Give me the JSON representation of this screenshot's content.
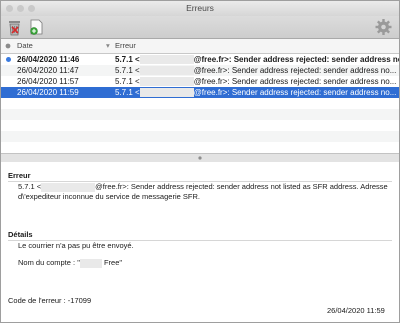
{
  "window": {
    "title": "Erreurs"
  },
  "toolbar": {
    "delete_icon": "trash-icon",
    "new_message_icon": "document-add-icon",
    "settings_icon": "gear-icon"
  },
  "table": {
    "columns": [
      "Date",
      "Erreur"
    ],
    "rows": [
      {
        "date": "26/04/2020 11:46",
        "prefix": "5.7.1 <",
        "suffix": "@free.fr>: Sender address rejected: sender address not",
        "bold": true,
        "unread": true,
        "selected": false
      },
      {
        "date": "26/04/2020 11:47",
        "prefix": "5.7.1 <",
        "suffix": "@free.fr>: Sender address rejected: sender address no...",
        "bold": false,
        "unread": false,
        "selected": false
      },
      {
        "date": "26/04/2020 11:57",
        "prefix": "5.7.1 <",
        "suffix": "@free.fr>: Sender address rejected: sender address no...",
        "bold": false,
        "unread": false,
        "selected": false
      },
      {
        "date": "26/04/2020 11:59",
        "prefix": "5.7.1 <",
        "suffix": "@free.fr>: Sender address rejected: sender address no...",
        "bold": false,
        "unread": false,
        "selected": true
      }
    ]
  },
  "detail": {
    "error_title": "Erreur",
    "error_prefix": "5.7.1 <",
    "error_line1_suffix": "@free.fr>: Sender address rejected: sender address not listed as SFR address. Adresse",
    "error_line2": "d\\'expediteur inconnue du service de messagerie SFR.",
    "details_title": "Détails",
    "message": "Le courrier n'a pas pu être envoyé.",
    "account_prefix": "Nom du compte : \"",
    "account_suffix": " Free\"",
    "code_label": "Code de l'erreur : -17099",
    "timestamp": "26/04/2020 11:59"
  },
  "colors": {
    "selection": "#2f6dd3",
    "unread_dot": "#3a7be0"
  }
}
